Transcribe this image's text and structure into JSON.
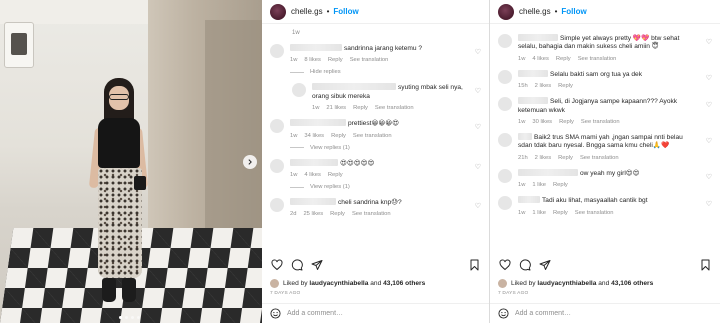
{
  "post": {
    "username": "chelle.gs",
    "follow_label": "Follow",
    "separator": "•"
  },
  "photo": {
    "carousel_dots": 4,
    "active_dot": 0
  },
  "panel1": {
    "top_time": "1w",
    "comments": [
      {
        "text": "sandrinna jarang ketemu ?",
        "time": "1w",
        "likes": "8 likes",
        "reply": "Reply",
        "translate": "See translation",
        "after": "Hide replies"
      },
      {
        "text": "syuting mbak seli nya, orang sibuk mereka",
        "time": "1w",
        "likes": "21 likes",
        "reply": "Reply",
        "translate": "See translation",
        "is_reply": true
      },
      {
        "text": "prettiest😀😀😀😍",
        "time": "1w",
        "likes": "34 likes",
        "reply": "Reply",
        "translate": "See translation",
        "after": "View replies (1)"
      },
      {
        "text": "😍😍😍😍😍",
        "time": "1w",
        "likes": "4 likes",
        "reply": "Reply",
        "after": "View replies (1)"
      },
      {
        "text": "cheli sandrina knp😓?",
        "time": "2d",
        "likes": "25 likes",
        "reply": "Reply",
        "translate": "See translation"
      }
    ],
    "liked_by_prefix": "Liked by",
    "liked_by_user": "laudyacynthiabella",
    "liked_by_and": "and",
    "liked_by_count": "43,106 others",
    "date": "7 DAYS AGO",
    "add_comment_placeholder": "Add a comment…"
  },
  "panel2": {
    "comments": [
      {
        "text": "Simple yet always pretty 💖💖 btw sehat selalu, bahagia dan makin sukess cheli amiin 😇",
        "time": "1w",
        "likes": "4 likes",
        "reply": "Reply",
        "translate": "See translation"
      },
      {
        "text": "Selalu bakti sam org tua ya dek",
        "time": "15h",
        "likes": "2 likes",
        "reply": "Reply"
      },
      {
        "text": "Seli, di Jogjanya sampe kapaann??? Ayokk ketemuan wkwk",
        "time": "1w",
        "likes": "30 likes",
        "reply": "Reply",
        "translate": "See translation"
      },
      {
        "text": "Baik2 trus SMA mami yah ,jngan sampai nnti belau sdan tdak baru nyesal. Bngga sama kmu cheli🙏❤️",
        "time": "21h",
        "likes": "2 likes",
        "reply": "Reply",
        "translate": "See translation"
      },
      {
        "text": "ow yeah my girl😍😍",
        "time": "1w",
        "likes": "1 like",
        "reply": "Reply"
      },
      {
        "text": "Tadi aku lihat, masyaallah cantik bgt",
        "time": "1w",
        "likes": "1 like",
        "reply": "Reply",
        "translate": "See translation"
      }
    ],
    "liked_by_prefix": "Liked by",
    "liked_by_user": "laudyacynthiabella",
    "liked_by_and": "and",
    "liked_by_count": "43,106 others",
    "date": "7 DAYS AGO",
    "add_comment_placeholder": "Add a comment…"
  },
  "icons": {
    "heart": "heart-icon",
    "comment": "comment-icon",
    "share": "share-icon",
    "save": "bookmark-icon",
    "emoji": "emoji-icon",
    "next": "chevron-right-icon"
  },
  "colors": {
    "link_blue": "#0095f6",
    "muted_gray": "#8e8e8e",
    "text": "#262626"
  }
}
